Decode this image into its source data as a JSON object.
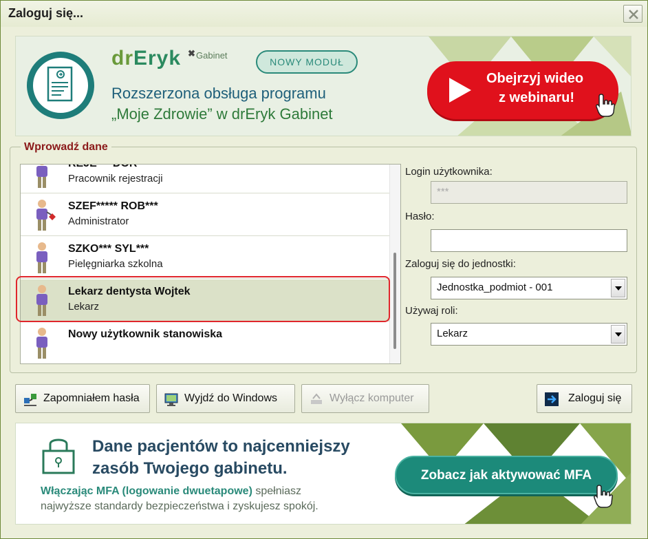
{
  "window": {
    "title": "Zaloguj się..."
  },
  "banner_top": {
    "brand_dr": "dr",
    "brand_eryk": "Eryk",
    "brand_x": "✖",
    "brand_sub": "Gabinet",
    "badge": "NOWY MODUŁ",
    "line1": "Rozszerzona obsługa programu",
    "line2": "„Moje Zdrowie” w drEryk Gabinet",
    "video_line1": "Obejrzyj wideo",
    "video_line2": "z webinaru!"
  },
  "group": {
    "legend": "Wprowadź dane"
  },
  "users": [
    {
      "name": "REJE*** DOR",
      "role": "Pracownik rejestracji",
      "icon": "user-icon"
    },
    {
      "name": "SZEF***** ROB***",
      "role": "Administrator",
      "icon": "admin-user-icon"
    },
    {
      "name": "SZKO*** SYL***",
      "role": "Pielęgniarka szkolna",
      "icon": "user-icon"
    },
    {
      "name": "Lekarz dentysta Wojtek",
      "role": "Lekarz",
      "icon": "user-icon",
      "selected": true
    },
    {
      "name": "Nowy użytkownik stanowiska",
      "role": "",
      "icon": "user-icon"
    }
  ],
  "form": {
    "login_label": "Login użytkownika:",
    "login_value": "***",
    "password_label": "Hasło:",
    "password_value": "",
    "unit_label": "Zaloguj się do jednostki:",
    "unit_value": "Jednostka_podmiot - 001",
    "role_label": "Używaj roli:",
    "role_value": "Lekarz"
  },
  "buttons": {
    "forgot": "Zapomniałem hasła",
    "exit_windows": "Wyjdź do Windows",
    "shutdown": "Wyłącz komputer",
    "login": "Zaloguj się"
  },
  "banner_bottom": {
    "headline1": "Dane pacjentów to najcenniejszy",
    "headline2": "zasób Twojego gabinetu.",
    "body_bold": "Włączając MFA (logowanie dwuetapowe)",
    "body_rest": " spełniasz",
    "body2": "najwyższe standardy bezpieczeństwa i zyskujesz spokój.",
    "cta": "Zobacz jak aktywować MFA"
  },
  "colors": {
    "accent_red": "#e0111c",
    "teal": "#1c8a7a",
    "legend": "#8b1a1a",
    "window_bg": "#ecefdb"
  }
}
